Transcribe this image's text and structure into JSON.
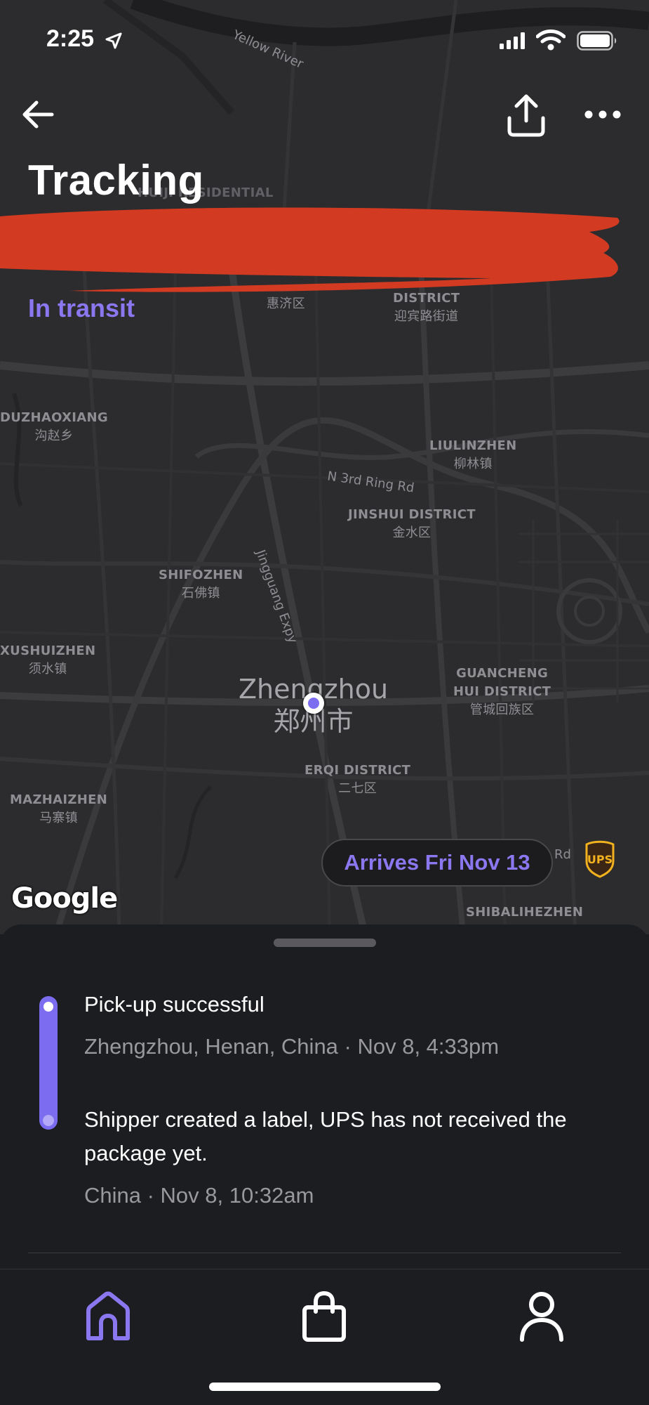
{
  "status_bar": {
    "time": "2:25"
  },
  "header": {
    "title": "Tracking",
    "status": "In transit"
  },
  "map": {
    "city": {
      "name": "Zhengzhou",
      "name_zh": "郑州市"
    },
    "labels": [
      {
        "en": "DUZHAOXIANG",
        "zh": "沟赵乡"
      },
      {
        "en": "LIULINZHEN",
        "zh": "柳林镇"
      },
      {
        "en": "JINSHUI DISTRICT",
        "zh": "金水区"
      },
      {
        "en": "SHIFOZHEN",
        "zh": "石佛镇"
      },
      {
        "en": "XUSHUIZHEN",
        "zh": "须水镇"
      },
      {
        "en": "GUANCHENG",
        "en2": "HUI DISTRICT",
        "zh": "管城回族区"
      },
      {
        "en": "ERQI DISTRICT",
        "zh": "二七区"
      },
      {
        "en": "MAZHAIZHEN",
        "zh": "马寨镇"
      },
      {
        "en": "SHIBALIHEZHEN",
        "zh": ""
      },
      {
        "en": "DISTRICT",
        "zh": "迎宾路街道"
      },
      {
        "en": "",
        "zh": "惠济区"
      },
      {
        "en": "HUIJI RESIDENTIAL",
        "zh": ""
      }
    ],
    "roads": {
      "river": "Yellow River",
      "ring": "N 3rd Ring Rd",
      "expressway": "Jingguang Expy",
      "rd": "Rd"
    },
    "attribution": "Google",
    "carrier_logo": "UPS",
    "arrival_pill": "Arrives Fri Nov 13",
    "colors": {
      "accent": "#8b78f0",
      "map_bg": "#2c2c2e",
      "redaction": "#d33a22"
    }
  },
  "events": [
    {
      "title": "Pick-up successful",
      "meta": "Zhengzhou, Henan, China · Nov 8, 4:33pm"
    },
    {
      "title": "Shipper created a label, UPS has not received the package yet.",
      "meta": "China · Nov 8, 10:32am"
    }
  ],
  "tabs": [
    {
      "icon": "home-icon",
      "active": true
    },
    {
      "icon": "shopping-bag-icon",
      "active": false
    },
    {
      "icon": "profile-icon",
      "active": false
    }
  ]
}
